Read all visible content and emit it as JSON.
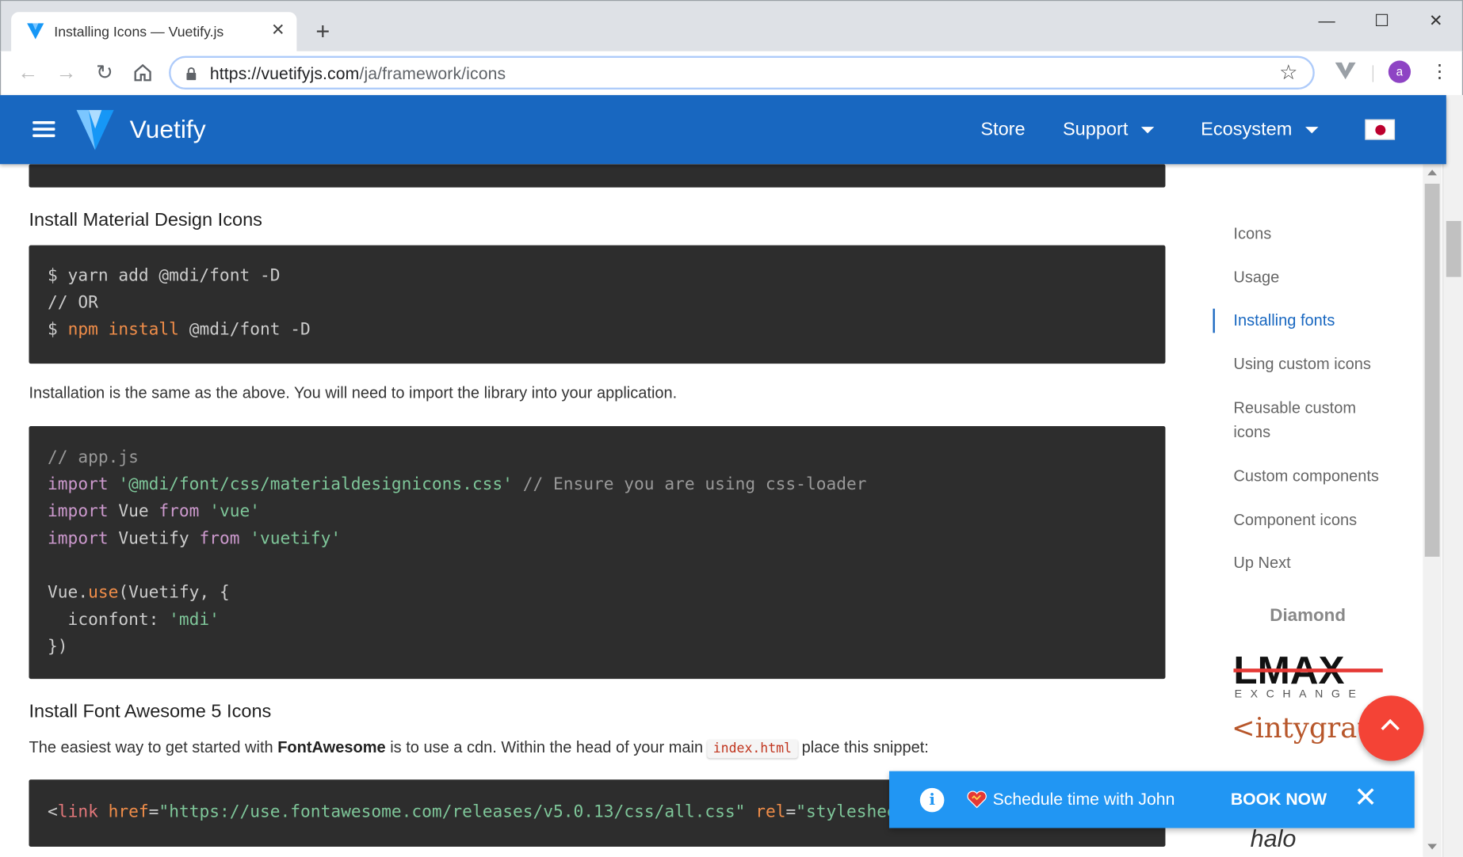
{
  "browser": {
    "tab_title": "Installing Icons — Vuetify.js",
    "tab_close": "✕",
    "new_tab": "+",
    "url_host": "https://vuetifyjs.com",
    "url_path": "/ja/framework/icons",
    "avatar_letter": "a",
    "controls": {
      "minimize": "—",
      "maximize": "☐",
      "close": "✕"
    },
    "icons": [
      "back-icon",
      "forward-icon",
      "reload-icon",
      "home-icon",
      "lock-icon",
      "star-icon",
      "kebab-menu-icon"
    ]
  },
  "appbar": {
    "brand": "Vuetify",
    "store": "Store",
    "support": "Support",
    "ecosystem": "Ecosystem",
    "color": "#1867c0"
  },
  "main": {
    "h_mdi": "Install Material Design Icons",
    "mdi_code": [
      [
        {
          "t": "$ yarn add @mdi/font -D"
        }
      ],
      [
        {
          "t": "// OR"
        }
      ],
      [
        {
          "t": "$ "
        },
        {
          "t": "npm install",
          "c": "c-fn"
        },
        {
          "t": " @mdi/font -D"
        }
      ]
    ],
    "p_install": "Installation is the same as the above. You will need to import the library into your application.",
    "app_code": [
      [
        {
          "t": "// app.js",
          "c": "c-comment"
        }
      ],
      [
        {
          "t": "import",
          "c": "c-kw"
        },
        {
          "t": " "
        },
        {
          "t": "'@mdi/font/css/materialdesignicons.css'",
          "c": "c-str"
        },
        {
          "t": " "
        },
        {
          "t": "// Ensure you are using css-loader",
          "c": "c-comment"
        }
      ],
      [
        {
          "t": "import",
          "c": "c-kw"
        },
        {
          "t": " Vue "
        },
        {
          "t": "from",
          "c": "c-kw"
        },
        {
          "t": " "
        },
        {
          "t": "'vue'",
          "c": "c-str"
        }
      ],
      [
        {
          "t": "import",
          "c": "c-kw"
        },
        {
          "t": " Vuetify "
        },
        {
          "t": "from",
          "c": "c-kw"
        },
        {
          "t": " "
        },
        {
          "t": "'vuetify'",
          "c": "c-str"
        }
      ],
      [
        {
          "t": " "
        }
      ],
      [
        {
          "t": "Vue."
        },
        {
          "t": "use",
          "c": "c-fn"
        },
        {
          "t": "(Vuetify, {"
        }
      ],
      [
        {
          "t": "  iconfont: "
        },
        {
          "t": "'mdi'",
          "c": "c-str"
        }
      ],
      [
        {
          "t": "})"
        }
      ]
    ],
    "h_fa": "Install Font Awesome 5 Icons",
    "p_fa_before": "The easiest way to get started with ",
    "p_fa_bold": "FontAwesome",
    "p_fa_middle": " is to use a cdn. Within the head of your main ",
    "p_fa_code": "index.html",
    "p_fa_after": " place this snippet:",
    "fa_code": [
      [
        {
          "t": "<"
        },
        {
          "t": "link",
          "c": "c-tag"
        },
        {
          "t": " "
        },
        {
          "t": "href",
          "c": "c-attr"
        },
        {
          "t": "="
        },
        {
          "t": "\"https://use.fontawesome.com/releases/v5.0.13/css/all.css\"",
          "c": "c-str"
        },
        {
          "t": " "
        },
        {
          "t": "rel",
          "c": "c-attr"
        },
        {
          "t": "="
        },
        {
          "t": "\"stylesheet\"",
          "c": "c-str"
        },
        {
          "t": ">"
        }
      ]
    ]
  },
  "toc": {
    "items": [
      {
        "label": "Icons",
        "active": false
      },
      {
        "label": "Usage",
        "active": false
      },
      {
        "label": "Installing fonts",
        "active": true
      },
      {
        "label": "Using custom icons",
        "active": false
      },
      {
        "label": "Reusable custom\nicons",
        "active": false
      },
      {
        "label": "Custom components",
        "active": false
      },
      {
        "label": "Component icons",
        "active": false
      },
      {
        "label": "Up Next",
        "active": false
      }
    ],
    "sponsor_heading": "Diamond",
    "sponsor_lmax": "LMAX",
    "sponsor_lmax_sub": "EXCHANGE",
    "sponsor_inty": "<intygrate",
    "sponsor_halo": "halo"
  },
  "snackbar": {
    "info_glyph": "i",
    "text": "Schedule time with John",
    "action": "BOOK NOW",
    "close": "✕",
    "color": "#2196f3"
  }
}
